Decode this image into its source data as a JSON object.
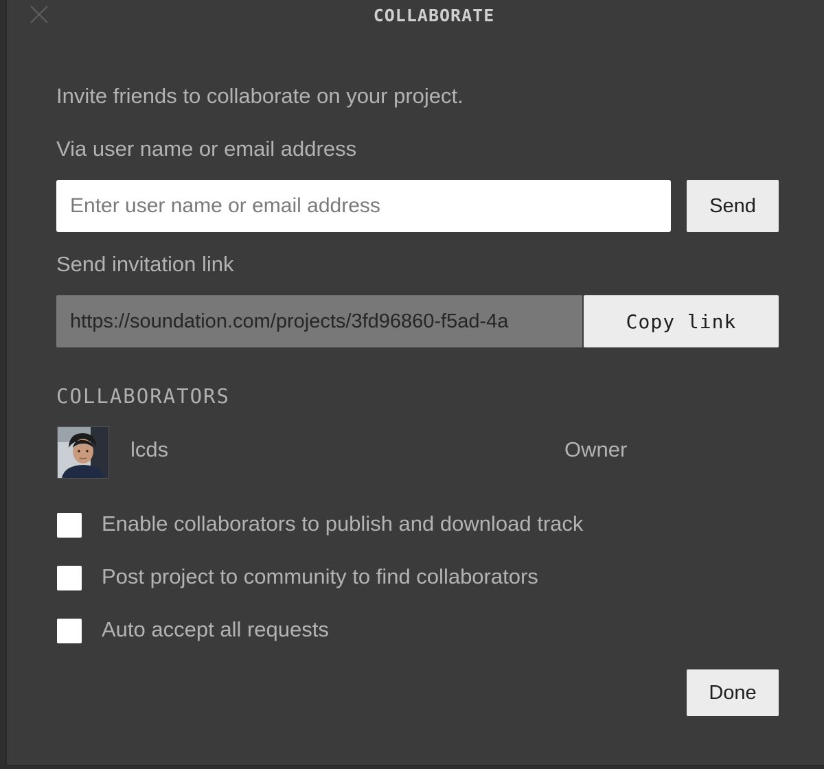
{
  "dialog": {
    "title": "COLLABORATE",
    "intro": "Invite friends to collaborate on your project.",
    "via_label": "Via user name or email address",
    "user_input": {
      "value": "",
      "placeholder": "Enter user name or email address"
    },
    "send_label": "Send",
    "invite_label": "Send invitation link",
    "invite_link": "https://soundation.com/projects/3fd96860-f5ad-4a",
    "copy_label": "Copy link",
    "collaborators_heading": "COLLABORATORS",
    "collaborators": [
      {
        "name": "lcds",
        "role": "Owner",
        "avatar_icon": "user-avatar"
      }
    ],
    "options": [
      {
        "label": "Enable collaborators to publish and download track",
        "checked": false
      },
      {
        "label": "Post project to community to find collaborators",
        "checked": false
      },
      {
        "label": "Auto accept all requests",
        "checked": false
      }
    ],
    "done_label": "Done",
    "close_icon": "close-icon"
  },
  "colors": {
    "dialog_background": "#3b3b3b",
    "text": "#b3b3b3",
    "button_background": "#ececec",
    "link_box_background": "#787878",
    "input_background": "#ffffff"
  }
}
